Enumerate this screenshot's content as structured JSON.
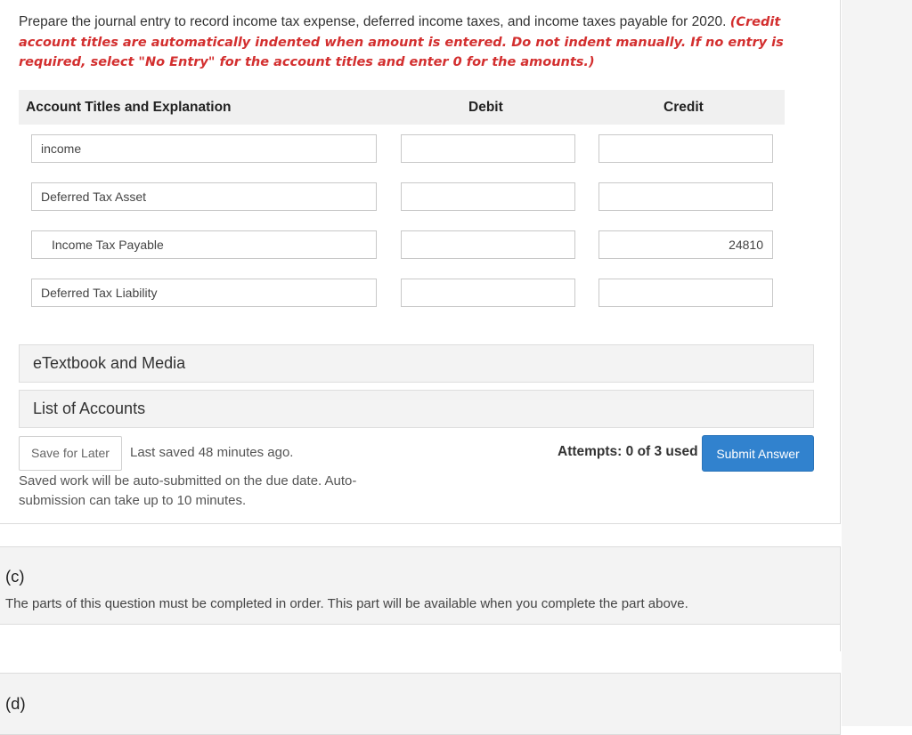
{
  "instructions": {
    "text": "Prepare the journal entry to record income tax expense, deferred income taxes, and income taxes payable for 2020.",
    "note": "(Credit account titles are automatically indented when amount is entered. Do not indent manually. If no entry is required, select \"No Entry\" for the account titles and enter 0 for the amounts.)"
  },
  "journal": {
    "headers": {
      "account": "Account Titles and Explanation",
      "debit": "Debit",
      "credit": "Credit"
    },
    "rows": [
      {
        "account": "income",
        "debit": "",
        "credit": ""
      },
      {
        "account": "Deferred Tax Asset",
        "debit": "",
        "credit": ""
      },
      {
        "account": "Income Tax Payable",
        "debit": "",
        "credit": "24810"
      },
      {
        "account": "Deferred Tax Liability",
        "debit": "",
        "credit": ""
      }
    ]
  },
  "resources": {
    "etextbook": "eTextbook and Media",
    "accounts": "List of Accounts"
  },
  "footer": {
    "save_label": "Save for Later",
    "last_saved": "Last saved 48 minutes ago.",
    "autosubmit": "Saved work will be auto-submitted on the due date. Auto-submission can take up to 10 minutes.",
    "attempts": "Attempts: 0 of 3 used",
    "submit_label": "Submit Answer"
  },
  "parts": {
    "c_label": "(c)",
    "c_text": "The parts of this question must be completed in order. This part will be available when you complete the part above.",
    "d_label": "(d)"
  }
}
